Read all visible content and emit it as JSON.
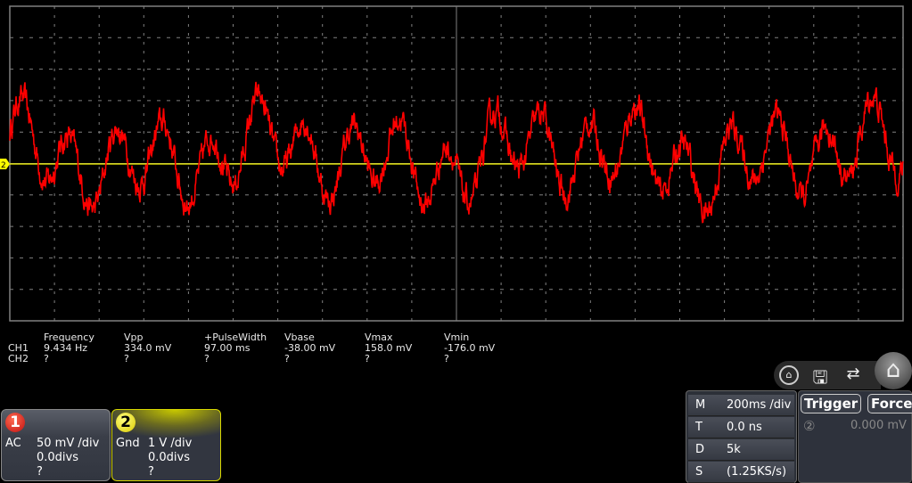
{
  "channel_marker": "2",
  "measurements": {
    "headers": [
      "Frequency",
      "Vpp",
      "+PulseWidth",
      "Vbase",
      "Vmax",
      "Vmin"
    ],
    "rows": [
      {
        "label": "CH1",
        "values": [
          "9.434 Hz",
          "334.0 mV",
          "97.00 ms",
          "-38.00 mV",
          "158.0 mV",
          "-176.0 mV"
        ]
      },
      {
        "label": "CH2",
        "values": [
          "?",
          "?",
          "?",
          "?",
          "?",
          "?"
        ]
      }
    ]
  },
  "ch1": {
    "badge": "1",
    "coupling": "AC",
    "scale": "50 mV /div",
    "offset": "0.0divs",
    "probe": "?"
  },
  "ch2": {
    "badge": "2",
    "coupling": "Gnd",
    "scale": "1 V /div",
    "offset": "0.0divs",
    "probe": "?"
  },
  "timebase": {
    "m_label": "M",
    "m_value": "200ms /div",
    "t_label": "T",
    "t_value": "0.0 ns",
    "d_label": "D",
    "d_value": "5k",
    "s_label": "S",
    "s_value": "(1.25KS/s)"
  },
  "trigger": {
    "trigger_label": "Trigger",
    "force_label": "Force",
    "source": "②",
    "level": "0.000 mV"
  },
  "colors": {
    "ch1": "#ff0000",
    "ch2": "#ffff00",
    "grid": "#808080"
  }
}
